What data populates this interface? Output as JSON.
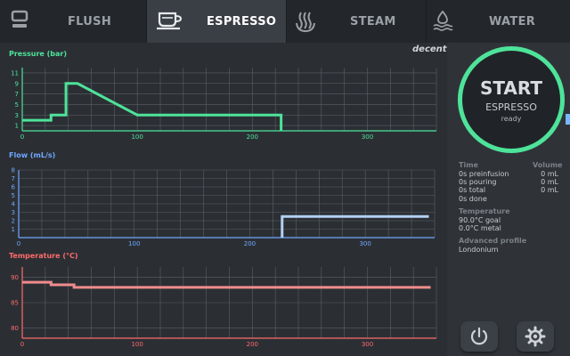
{
  "tabs": [
    {
      "label": "FLUSH",
      "icon": "flush-icon",
      "active": false
    },
    {
      "label": "ESPRESSO",
      "icon": "cup-icon",
      "active": true
    },
    {
      "label": "STEAM",
      "icon": "steam-icon",
      "active": false
    },
    {
      "label": "WATER",
      "icon": "water-icon",
      "active": false
    }
  ],
  "logo": "decent",
  "start": {
    "label": "START",
    "mode": "ESPRESSO",
    "status": "ready"
  },
  "info": {
    "time_header": "Time",
    "volume_header": "Volume",
    "rows": [
      {
        "time": "0s preinfusion",
        "volume": "0 mL"
      },
      {
        "time": "0s pouring",
        "volume": "0 mL"
      },
      {
        "time": "0s total",
        "volume": "0 mL"
      },
      {
        "time": "0s done",
        "volume": ""
      }
    ],
    "temperature_header": "Temperature",
    "temperature_goal": "90.0°C goal",
    "temperature_metal": "0.0°C metal",
    "profile_header": "Advanced profile",
    "profile_name": "Londonium"
  },
  "colors": {
    "pressure": "#4ee39a",
    "flow": "#6fa8ff",
    "flow_line": "#b3d0f2",
    "temperature": "#ff6b6b",
    "temperature_line": "#f08c8c",
    "ring": "#4ee39a"
  },
  "chart_data": [
    {
      "type": "line",
      "title": "Pressure (bar)",
      "xlim": [
        0,
        360
      ],
      "ylim": [
        0,
        12
      ],
      "xticks": [
        0,
        100,
        200,
        300
      ],
      "yticks": [
        1,
        3,
        5,
        7,
        9,
        11
      ],
      "grid": true,
      "series": [
        {
          "x": [
            0,
            25,
            25,
            38,
            38,
            48,
            100,
            225,
            225
          ],
          "y": [
            2,
            2,
            3,
            3,
            9,
            9,
            3,
            3,
            0
          ]
        }
      ]
    },
    {
      "type": "line",
      "title": "Flow (mL/s)",
      "xlim": [
        0,
        360
      ],
      "ylim": [
        0,
        8
      ],
      "xticks": [
        0,
        100,
        200,
        300
      ],
      "yticks": [
        1,
        2,
        3,
        4,
        5,
        6,
        7,
        8
      ],
      "grid": true,
      "series": [
        {
          "x": [
            228,
            228,
            355
          ],
          "y": [
            0,
            2.5,
            2.5
          ]
        }
      ]
    },
    {
      "type": "line",
      "title": "Temperature (°C)",
      "xlim": [
        0,
        360
      ],
      "ylim": [
        78,
        92
      ],
      "xticks": [
        0,
        100,
        200,
        300
      ],
      "yticks": [
        80,
        85,
        90
      ],
      "grid": true,
      "series": [
        {
          "x": [
            0,
            25,
            25,
            45,
            45,
            355
          ],
          "y": [
            89,
            89,
            88.5,
            88.5,
            88,
            88
          ]
        }
      ]
    }
  ]
}
